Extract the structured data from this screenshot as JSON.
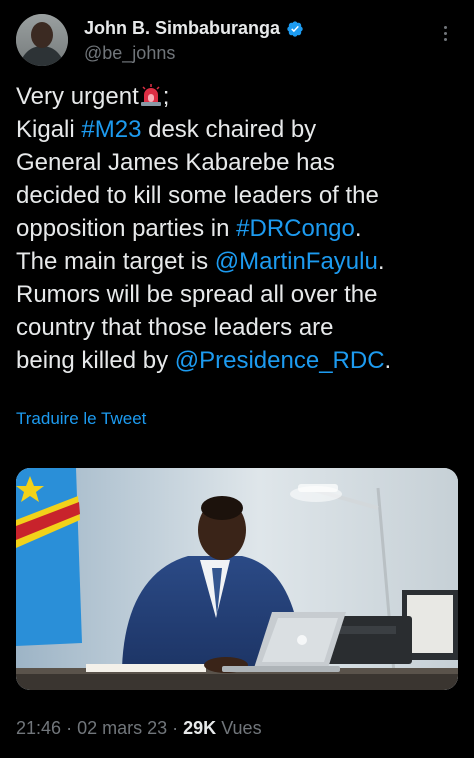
{
  "author": {
    "name": "John B. Simbaburanga",
    "handle": "@be_johns"
  },
  "tweet": {
    "line1_text": "Very urgent",
    "line1_punct": ";",
    "line2_pre": "Kigali ",
    "line2_tag": "#M23",
    "line2_post": " desk chaired by",
    "line3": "General James Kabarebe has",
    "line4": "decided to kill some leaders of the",
    "line5_pre": "opposition parties in ",
    "line5_tag": "#DRCongo",
    "line5_post": ".",
    "line6_pre": "The main target is ",
    "line6_mention": "@MartinFayulu",
    "line6_post": ".",
    "line7": "Rumors will be spread all over the",
    "line8": "country that those leaders are",
    "line9_pre": "being killed by ",
    "line9_mention": "@Presidence_RDC",
    "line9_post": "."
  },
  "translate_label": "Traduire le Tweet",
  "meta": {
    "time": "21:46",
    "separator": "·",
    "date": "02 mars 23",
    "views_count": "29K",
    "views_label": "Vues"
  },
  "colors": {
    "background": "#000000",
    "text": "#e7e9ea",
    "muted": "#71767b",
    "link": "#1d9bf0"
  },
  "icons": [
    "verified-badge-icon",
    "more-options-icon",
    "siren-emoji-icon"
  ]
}
